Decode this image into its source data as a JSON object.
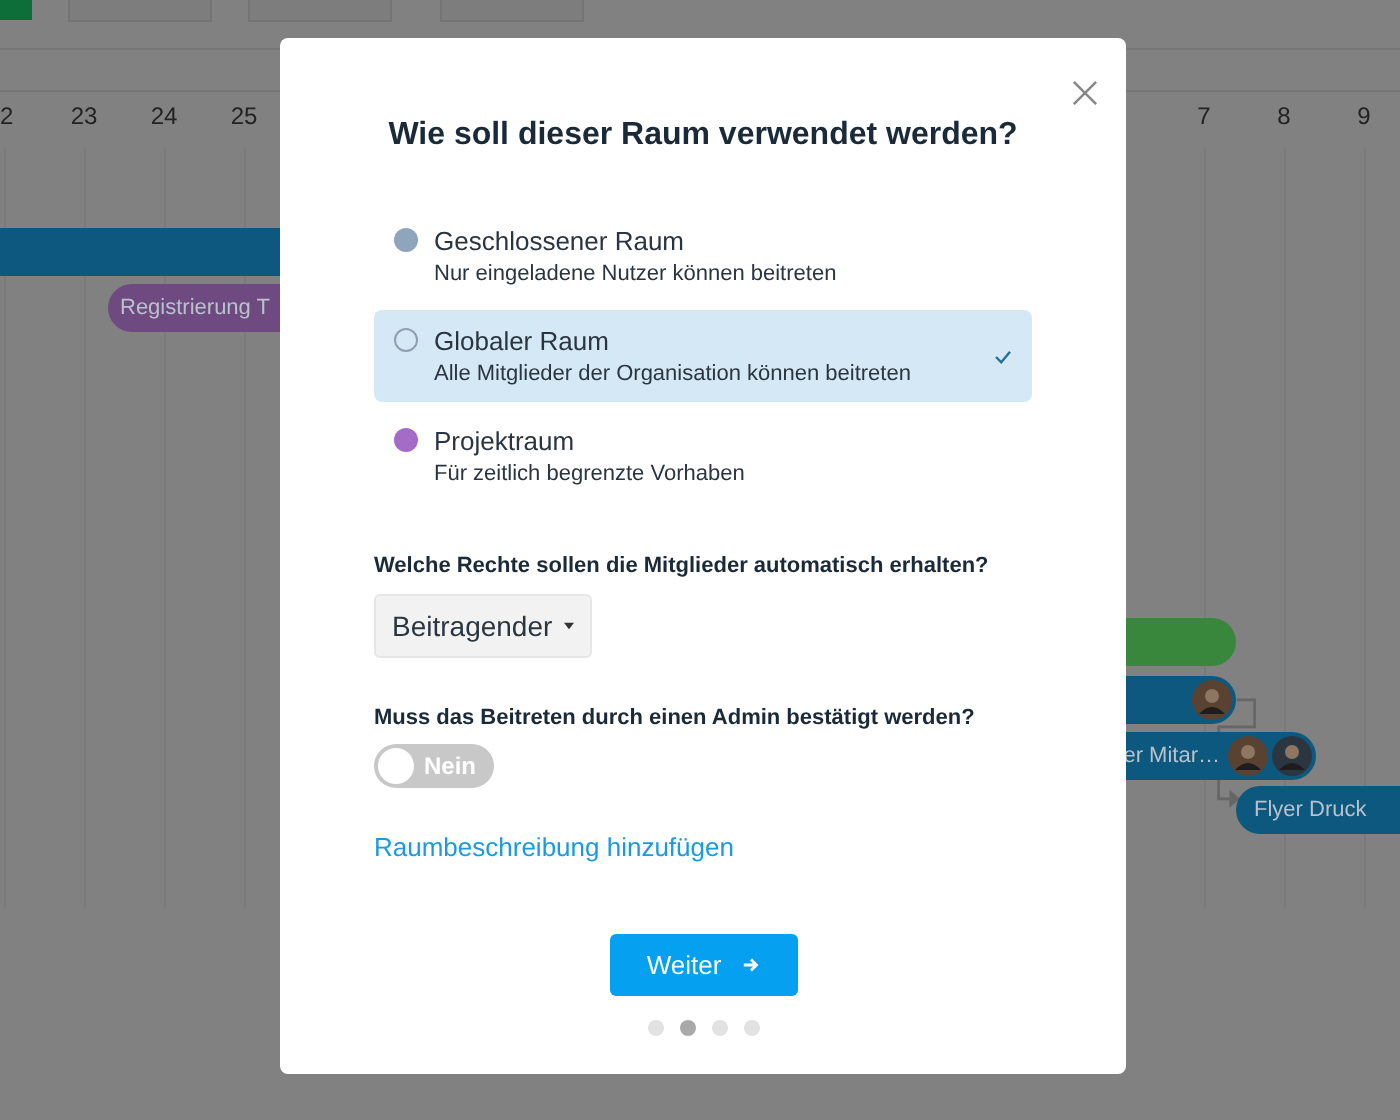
{
  "background": {
    "days": [
      "2",
      "23",
      "24",
      "25",
      "7",
      "8",
      "9"
    ],
    "bars": [
      {
        "color": "#0d587e"
      },
      {
        "label": "Registrierung T",
        "color": "#6f4a80"
      },
      {
        "color": "#39873d"
      },
      {
        "color": "#0d587e",
        "avatars": [
          {
            "kind": "person"
          }
        ]
      },
      {
        "label": "er Mitar…",
        "color": "#0d587e",
        "avatars": [
          {
            "kind": "person"
          },
          {
            "kind": "person"
          }
        ]
      },
      {
        "label": "Flyer Druck",
        "color": "#0d587e"
      }
    ]
  },
  "dialog": {
    "title": "Wie soll dieser Raum verwendet werden?",
    "options": [
      {
        "title": "Geschlossener Raum",
        "description": "Nur eingeladene Nutzer können beitreten",
        "color": "#8fa5bd",
        "selected": false
      },
      {
        "title": "Globaler Raum",
        "description": "Alle Mitglieder der Organisation können beitreten",
        "color": "#8f9fb0",
        "selected": true
      },
      {
        "title": "Projektraum",
        "description": "Für zeitlich begrenzte Vorhaben",
        "color": "#a46cc6",
        "selected": false
      }
    ],
    "rights": {
      "label": "Welche Rechte sollen die Mitglieder automatisch erhalten?",
      "value": "Beitragender"
    },
    "approval": {
      "label": "Muss das Beitreten durch einen Admin bestätigt werden?",
      "on": false,
      "text": "Nein"
    },
    "link": "Raumbeschreibung hinzufügen",
    "button": "Weiter",
    "steps": [
      {
        "selected": false
      },
      {
        "selected": true
      },
      {
        "selected": false
      },
      {
        "selected": false
      }
    ]
  }
}
